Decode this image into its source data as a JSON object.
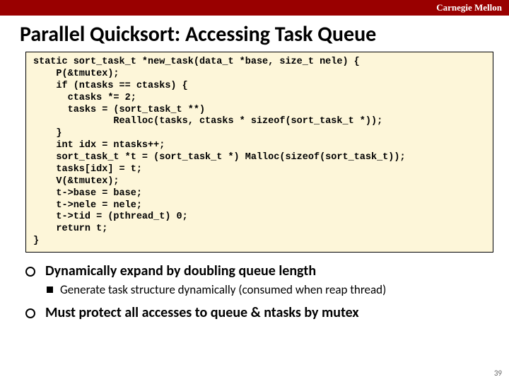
{
  "header": {
    "brand": "Carnegie Mellon"
  },
  "title": "Parallel Quicksort: Accessing Task Queue",
  "code": "static sort_task_t *new_task(data_t *base, size_t nele) {\n    P(&tmutex);\n    if (ntasks == ctasks) {\n      ctasks *= 2;\n      tasks = (sort_task_t **)\n              Realloc(tasks, ctasks * sizeof(sort_task_t *));\n    }\n    int idx = ntasks++;\n    sort_task_t *t = (sort_task_t *) Malloc(sizeof(sort_task_t));\n    tasks[idx] = t;\n    V(&tmutex);\n    t->base = base;\n    t->nele = nele;\n    t->tid = (pthread_t) 0;\n    return t;\n}",
  "bullets": {
    "b1": "Dynamically expand by doubling queue length",
    "b1_sub": "Generate task structure dynamically (consumed when reap thread)",
    "b2": "Must protect all accesses to queue & ntasks by mutex"
  },
  "page": "39"
}
